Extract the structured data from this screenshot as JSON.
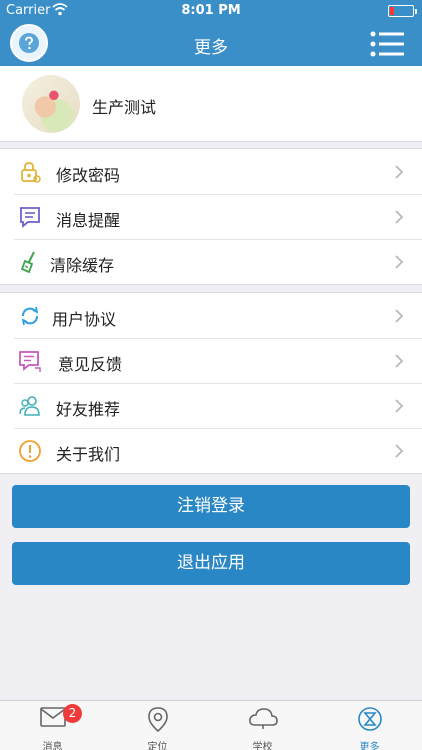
{
  "status_bar": {
    "carrier": "Carrier",
    "time": "8:01 PM"
  },
  "nav": {
    "title": "更多"
  },
  "profile": {
    "name": "生产测试"
  },
  "settings": [
    {
      "label": "修改密码",
      "icon": "lock-icon"
    },
    {
      "label": "消息提醒",
      "icon": "message-icon"
    },
    {
      "label": "清除缓存",
      "icon": "broom-icon"
    }
  ],
  "info": [
    {
      "label": "用户协议",
      "icon": "refresh-icon"
    },
    {
      "label": "意见反馈",
      "icon": "feedback-icon"
    },
    {
      "label": "好友推荐",
      "icon": "friends-icon"
    },
    {
      "label": "关于我们",
      "icon": "info-icon"
    }
  ],
  "buttons": {
    "logout": "注销登录",
    "exit": "退出应用"
  },
  "tabs": [
    {
      "label": "消息",
      "badge": "2"
    },
    {
      "label": "定位"
    },
    {
      "label": "学校"
    },
    {
      "label": "更多"
    }
  ],
  "colors": {
    "accent": "#3a8fc9",
    "button": "#2a87c6",
    "badge": "#f03b3b"
  }
}
